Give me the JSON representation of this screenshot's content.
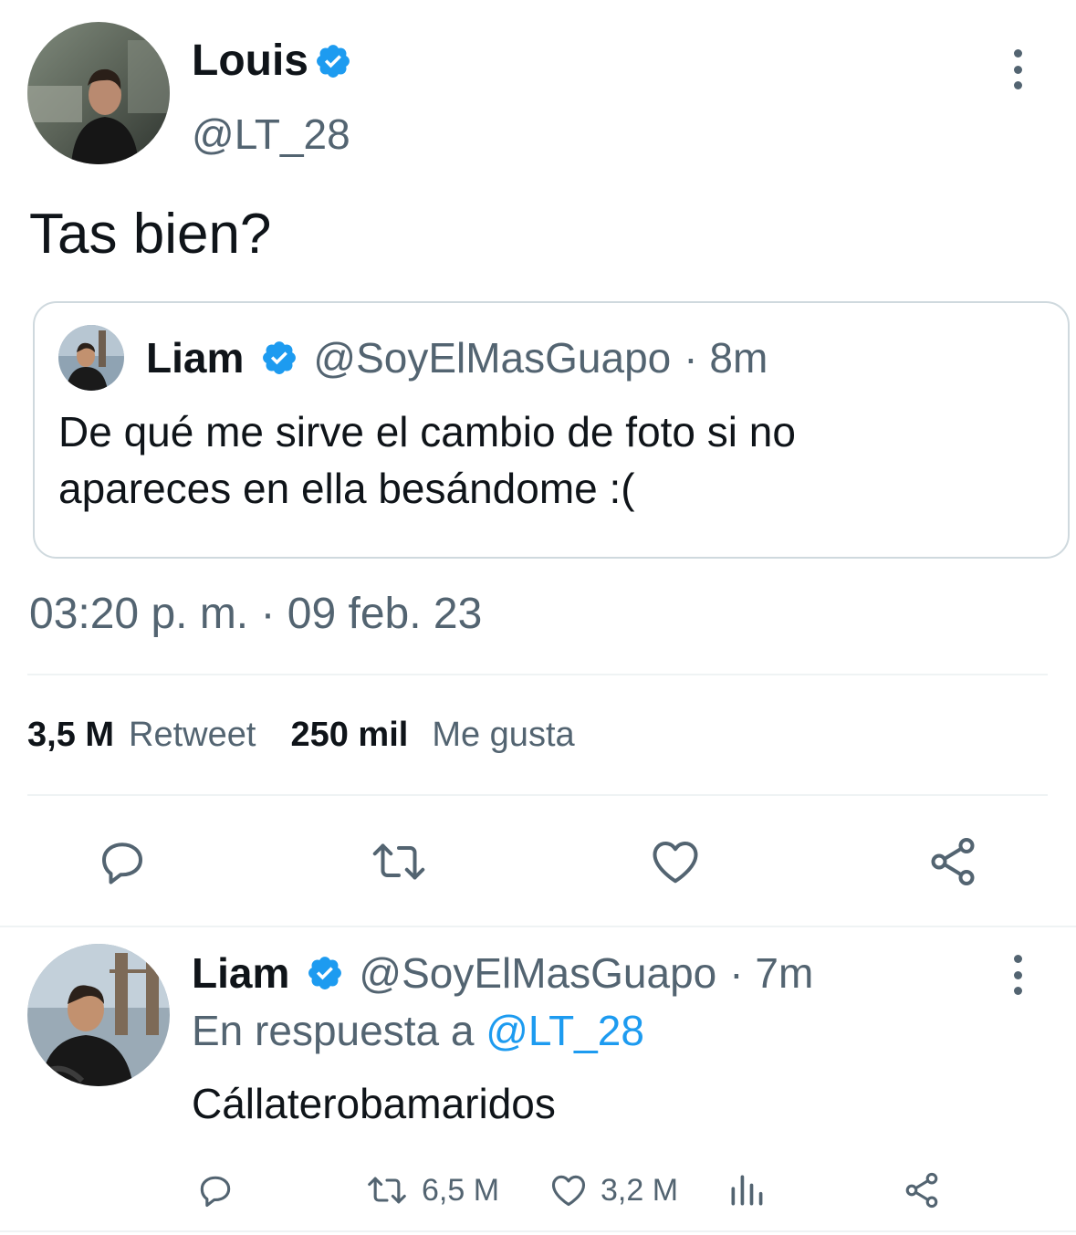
{
  "main_tweet": {
    "author_name": "Louis",
    "author_handle": "@LT_28",
    "text": "Tas bien?",
    "timestamp": "03:20 p. m. · 09 feb. 23",
    "stats": {
      "retweets_count": "3,5 M",
      "retweets_label": "Retweet",
      "likes_count": "250 mil",
      "likes_label": "Me gusta"
    }
  },
  "quoted_tweet": {
    "author_name": "Liam",
    "author_handle": "@SoyElMasGuapo",
    "time_ago": "· 8m",
    "text_line1": "De qué me sirve el cambio de foto si no",
    "text_line2": "apareces en ella besándome :("
  },
  "reply_tweet": {
    "author_name": "Liam",
    "author_handle": "@SoyElMasGuapo",
    "time_ago": "· 7m",
    "reply_prefix": "En respuesta a",
    "reply_to": "@LT_28",
    "text": "Cállaterobamaridos",
    "retweets": "6,5 M",
    "likes": "3,2 M"
  },
  "colors": {
    "accent": "#1d9bf0",
    "muted": "#536471",
    "divider": "#eff3f4"
  },
  "icons": [
    "verified-badge-icon",
    "more-options-icon",
    "reply-icon",
    "retweet-icon",
    "like-icon",
    "share-icon",
    "analytics-icon"
  ]
}
